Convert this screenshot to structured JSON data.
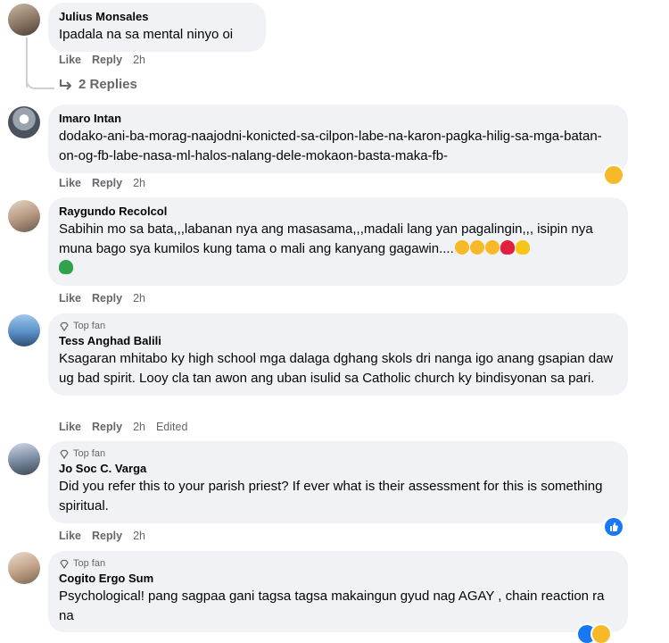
{
  "comments": [
    {
      "author": "Julius Monsales",
      "text": "Ipadala na sa mental ninyo oi",
      "like": "Like",
      "reply": "Reply",
      "time": "2h",
      "replies": "2 Replies"
    },
    {
      "author": "Imaro Intan",
      "text": "dodako-ani-ba-morag-naajodni-konicted-sa-cilpon-labe-na-karon-pagka-hilig-sa-mga-batan-on-og-fb-labe-nasa-ml-halos-nalang-dele-mokaon-basta-maka-fb-",
      "like": "Like",
      "reply": "Reply",
      "time": "2h"
    },
    {
      "author": "Raygundo Recolcol",
      "text": "Sabihin mo sa bata,,,labanan nya ang masasama,,,madali lang yan pagalingin,,, isipin nya muna bago sya kumilos kung tama o mali ang kanyang gagawin....",
      "like": "Like",
      "reply": "Reply",
      "time": "2h"
    },
    {
      "badge": "Top fan",
      "author": "Tess Anghad Balili",
      "text": "Ksagaran mhitabo ky high school mga dalaga dghang skols dri nanga igo anang gsapian daw ug bad spirit. Looy cla tan awon ang uban isulid sa Catholic church ky bindisyonan sa pari.",
      "like": "Like",
      "reply": "Reply",
      "time": "2h",
      "edited": "Edited"
    },
    {
      "badge": "Top fan",
      "author": "Jo Soc C. Varga",
      "text": "Did you refer this to your parish priest? If ever what is their assessment for this is something spiritual.",
      "like": "Like",
      "reply": "Reply",
      "time": "2h"
    },
    {
      "badge": "Top fan",
      "author": "Cogito Ergo Sum",
      "text": "Psychological! pang sagpaa gani tagsa tagsa makaingun gyud nag AGAY , chain reaction ra na"
    }
  ],
  "colors": {
    "bubble": "#f0f2f5",
    "meta": "#65676b",
    "like_blue": "#1877f2"
  },
  "icons": {
    "replies": "reply-arrow-icon",
    "topfan": "diamond-icon"
  }
}
